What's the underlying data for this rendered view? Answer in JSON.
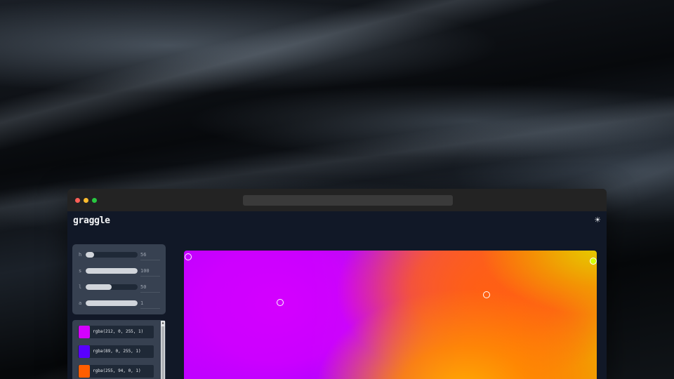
{
  "app": {
    "logo": "graggle",
    "theme_toggle_icon": "sun-icon",
    "theme_toggle_glyph": "☀"
  },
  "sliders": [
    {
      "label": "h",
      "value": "56",
      "fill": 0.16
    },
    {
      "label": "s",
      "value": "100",
      "fill": 1.0
    },
    {
      "label": "l",
      "value": "50",
      "fill": 0.5
    },
    {
      "label": "a",
      "value": "1",
      "fill": 1.0
    }
  ],
  "colors": [
    {
      "text": "rgba(212, 0, 255, 1)",
      "swatch": "#d400ff"
    },
    {
      "text": "rgba(89, 0, 255, 1)",
      "swatch": "#5900ff"
    },
    {
      "text": "rgba(255, 94, 0, 1)",
      "swatch": "#ff5e00"
    }
  ],
  "scrollbar": {
    "arrow_glyph": "▲"
  },
  "handles": [
    {
      "name": "gradient-handle-top-left",
      "color": "#d400ff",
      "selected": false
    },
    {
      "name": "gradient-handle-purple",
      "color": "#d400ff",
      "selected": false
    },
    {
      "name": "gradient-handle-orange",
      "color": "#ff5e00",
      "selected": false
    },
    {
      "name": "gradient-handle-top-right",
      "color": "#d4ff00",
      "selected": true
    }
  ],
  "colors_theme": {
    "window_bg": "#111827",
    "panel_bg": "#374151",
    "item_bg": "#1f2937"
  }
}
